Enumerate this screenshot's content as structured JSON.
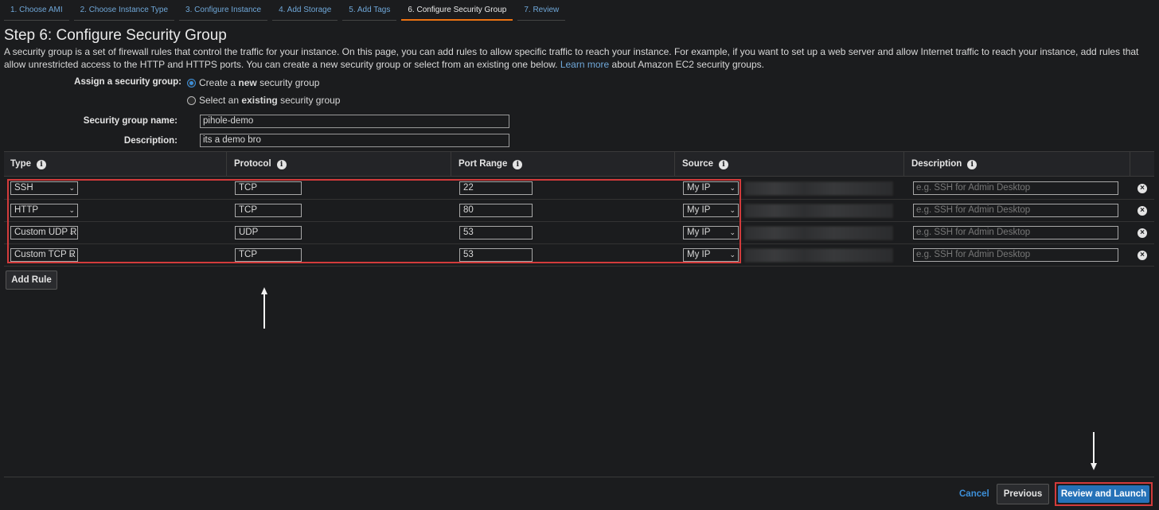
{
  "tabs": [
    {
      "label": "1. Choose AMI"
    },
    {
      "label": "2. Choose Instance Type"
    },
    {
      "label": "3. Configure Instance"
    },
    {
      "label": "4. Add Storage"
    },
    {
      "label": "5. Add Tags"
    },
    {
      "label": "6. Configure Security Group",
      "active": true
    },
    {
      "label": "7. Review"
    }
  ],
  "title": "Step 6: Configure Security Group",
  "intro": {
    "text": "A security group is a set of firewall rules that control the traffic for your instance. On this page, you can add rules to allow specific traffic to reach your instance. For example, if you want to set up a web server and allow Internet traffic to reach your instance, add rules that allow unrestricted access to the HTTP and HTTPS ports. You can create a new security group or select from an existing one below.",
    "link": "Learn more",
    "suffix": "about Amazon EC2 security groups."
  },
  "form": {
    "assign_label": "Assign a security group:",
    "option_new_prefix": "Create a",
    "option_new_bold": "new",
    "option_new_suffix": "security group",
    "option_existing_prefix": "Select an",
    "option_existing_bold": "existing",
    "option_existing_suffix": "security group",
    "name_label": "Security group name:",
    "name_value": "pihole-demo",
    "desc_label": "Description:",
    "desc_value": "its a demo bro"
  },
  "table": {
    "headers": {
      "type": "Type",
      "protocol": "Protocol",
      "port_range": "Port Range",
      "source": "Source",
      "description": "Description"
    },
    "rows": [
      {
        "type": "SSH",
        "protocol": "TCP",
        "port": "22",
        "source": "My IP",
        "desc_placeholder": "e.g. SSH for Admin Desktop"
      },
      {
        "type": "HTTP",
        "protocol": "TCP",
        "port": "80",
        "source": "My IP",
        "desc_placeholder": "e.g. SSH for Admin Desktop"
      },
      {
        "type": "Custom UDP R",
        "protocol": "UDP",
        "port": "53",
        "source": "My IP",
        "desc_placeholder": "e.g. SSH for Admin Desktop"
      },
      {
        "type": "Custom TCP R",
        "protocol": "TCP",
        "port": "53",
        "source": "My IP",
        "desc_placeholder": "e.g. SSH for Admin Desktop"
      }
    ],
    "add_rule": "Add Rule"
  },
  "footer": {
    "cancel": "Cancel",
    "previous": "Previous",
    "review": "Review and Launch"
  },
  "icons": {
    "info": "info-icon",
    "remove": "close-icon",
    "dropdown": "chevron-down-icon"
  },
  "colors": {
    "accent_tab": "#ec7211",
    "link": "#6fa7d8",
    "primary_button": "#2572b8",
    "highlight": "#d23b3b"
  }
}
